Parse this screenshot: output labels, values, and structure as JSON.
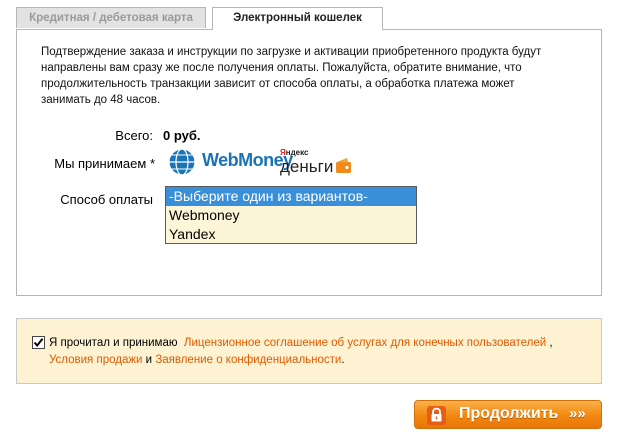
{
  "tabs": [
    {
      "label": "Кредитная / дебетовая карта",
      "active": false
    },
    {
      "label": "Электронный кошелек",
      "active": true
    }
  ],
  "intro_text": "Подтверждение заказа и инструкции по загрузке и активации приобретенного продукта будут направлены вам сразу же после получения оплаты. Пожалуйста, обратите внимание, что продолжительность транзакции зависит от способа оплаты, а обработка платежа может занимать до 48 часов.",
  "total": {
    "label": "Всего:",
    "value": "0 руб."
  },
  "accept": {
    "label": "Мы принимаем *",
    "logos": [
      "webmoney-logo",
      "yandex-money-logo"
    ]
  },
  "logos": {
    "webmoney": "WebMoney",
    "yandex_small_y": "Я",
    "yandex_small_rest": "ндекс",
    "yandex_big": "деньги"
  },
  "payment_method": {
    "label": "Способ оплаты",
    "options": [
      "-Выберите один из вариантов-",
      "Webmoney",
      "Yandex"
    ],
    "selected_index": 0
  },
  "agreement": {
    "checked": true,
    "prefix": "Я прочитал и принимаю",
    "link_license": "Лицензионное соглашение об услугах для конечных пользователей",
    "sep1": ",",
    "link_terms": "Условия продажи",
    "and": "и",
    "link_privacy": "Заявление о конфиденциальности",
    "end": "."
  },
  "continue_button": {
    "label": "Продолжить",
    "arrows": "»»"
  },
  "colors": {
    "accent_orange": "#f2870f",
    "link_orange": "#e05a00",
    "selected_blue": "#3a8fd9",
    "panel_cream": "#fdf3d3"
  }
}
